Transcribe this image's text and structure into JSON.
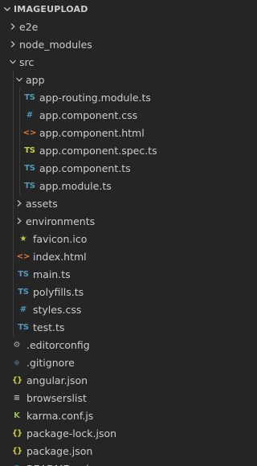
{
  "explorer": {
    "section_title": "IMAGEUPLOAD",
    "items": [
      {
        "label": "e2e",
        "kind": "folder",
        "expanded": false,
        "depth": 1
      },
      {
        "label": "node_modules",
        "kind": "folder",
        "expanded": false,
        "depth": 1
      },
      {
        "label": "src",
        "kind": "folder",
        "expanded": true,
        "depth": 1
      },
      {
        "label": "app",
        "kind": "folder",
        "expanded": true,
        "depth": 2
      },
      {
        "label": "app-routing.module.ts",
        "kind": "file",
        "icon": "typescript-icon",
        "depth": 3
      },
      {
        "label": "app.component.css",
        "kind": "file",
        "icon": "css-hash-icon",
        "depth": 3
      },
      {
        "label": "app.component.html",
        "kind": "file",
        "icon": "html-code-icon",
        "depth": 3
      },
      {
        "label": "app.component.spec.ts",
        "kind": "file",
        "icon": "typescript-spec-icon",
        "depth": 3
      },
      {
        "label": "app.component.ts",
        "kind": "file",
        "icon": "typescript-icon",
        "depth": 3
      },
      {
        "label": "app.module.ts",
        "kind": "file",
        "icon": "typescript-icon",
        "depth": 3
      },
      {
        "label": "assets",
        "kind": "folder",
        "expanded": false,
        "depth": 2
      },
      {
        "label": "environments",
        "kind": "folder",
        "expanded": false,
        "depth": 2
      },
      {
        "label": "favicon.ico",
        "kind": "file",
        "icon": "star-icon",
        "depth": 2
      },
      {
        "label": "index.html",
        "kind": "file",
        "icon": "html-code-icon",
        "depth": 2
      },
      {
        "label": "main.ts",
        "kind": "file",
        "icon": "typescript-icon",
        "depth": 2
      },
      {
        "label": "polyfills.ts",
        "kind": "file",
        "icon": "typescript-icon",
        "depth": 2
      },
      {
        "label": "styles.css",
        "kind": "file",
        "icon": "css-hash-icon",
        "depth": 2
      },
      {
        "label": "test.ts",
        "kind": "file",
        "icon": "typescript-icon",
        "depth": 2
      },
      {
        "label": ".editorconfig",
        "kind": "file",
        "icon": "gear-icon",
        "depth": 1
      },
      {
        "label": ".gitignore",
        "kind": "file",
        "icon": "git-icon",
        "depth": 1
      },
      {
        "label": "angular.json",
        "kind": "file",
        "icon": "json-braces-icon",
        "depth": 1
      },
      {
        "label": "browserslist",
        "kind": "file",
        "icon": "lines-icon",
        "depth": 1
      },
      {
        "label": "karma.conf.js",
        "kind": "file",
        "icon": "karma-icon",
        "depth": 1
      },
      {
        "label": "package-lock.json",
        "kind": "file",
        "icon": "json-braces-icon",
        "depth": 1
      },
      {
        "label": "package.json",
        "kind": "file",
        "icon": "json-braces-icon",
        "depth": 1
      },
      {
        "label": "README.md",
        "kind": "file",
        "icon": "info-icon",
        "depth": 1
      }
    ]
  },
  "icons": {
    "ts_glyph": "TS",
    "hash_glyph": "#",
    "html_glyph": "<>",
    "json_glyph": "{}",
    "star_glyph": "★",
    "gear_glyph": "⚙",
    "git_glyph": "◆",
    "lines_glyph": "≡",
    "karma_glyph": "K",
    "info_glyph": "ⓘ"
  },
  "colors": {
    "background": "#252526",
    "text": "#cccccc",
    "typescript": "#519aba",
    "spec_yellow": "#cbcb41",
    "html_orange": "#e37933",
    "karma_green": "#8dc149"
  }
}
